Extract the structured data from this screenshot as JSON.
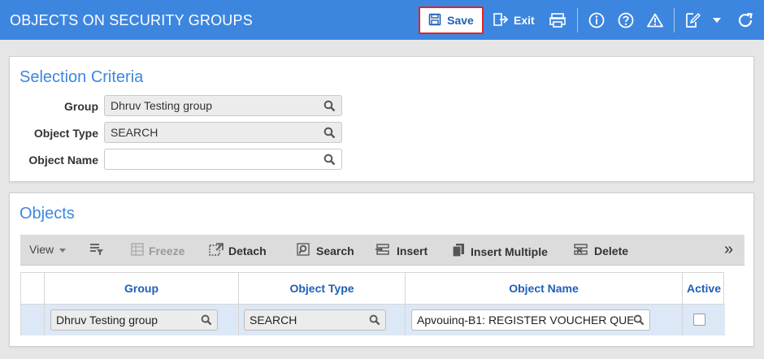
{
  "header": {
    "title": "OBJECTS ON SECURITY GROUPS",
    "save_label": "Save",
    "exit_label": "Exit",
    "icons": [
      "save-icon",
      "exit-icon",
      "print-icon",
      "info-icon",
      "help-icon",
      "warning-icon",
      "edit-icon",
      "dropdown-caret-icon",
      "refresh-icon"
    ]
  },
  "selection_criteria": {
    "title": "Selection Criteria",
    "fields": [
      {
        "label": "Group",
        "value": "Dhruv Testing group"
      },
      {
        "label": "Object Type",
        "value": "SEARCH"
      },
      {
        "label": "Object Name",
        "value": ""
      }
    ]
  },
  "objects": {
    "title": "Objects",
    "toolbar": {
      "view": "View",
      "freeze": "Freeze",
      "detach": "Detach",
      "search": "Search",
      "insert": "Insert",
      "insert_multiple": "Insert Multiple",
      "delete": "Delete",
      "more": "»"
    },
    "columns": [
      "Group",
      "Object Type",
      "Object Name",
      "Active"
    ],
    "rows": [
      {
        "group": "Dhruv Testing group",
        "object_type": "SEARCH",
        "object_name": "Apvouinq-B1: REGISTER VOUCHER QUE",
        "active": false
      }
    ]
  },
  "colors": {
    "header_bg": "#3d86e0",
    "accent": "#3d86e0",
    "header_text": "#1f5fb5",
    "highlight_border": "#e0242a",
    "selected_row": "#dde8f7"
  }
}
